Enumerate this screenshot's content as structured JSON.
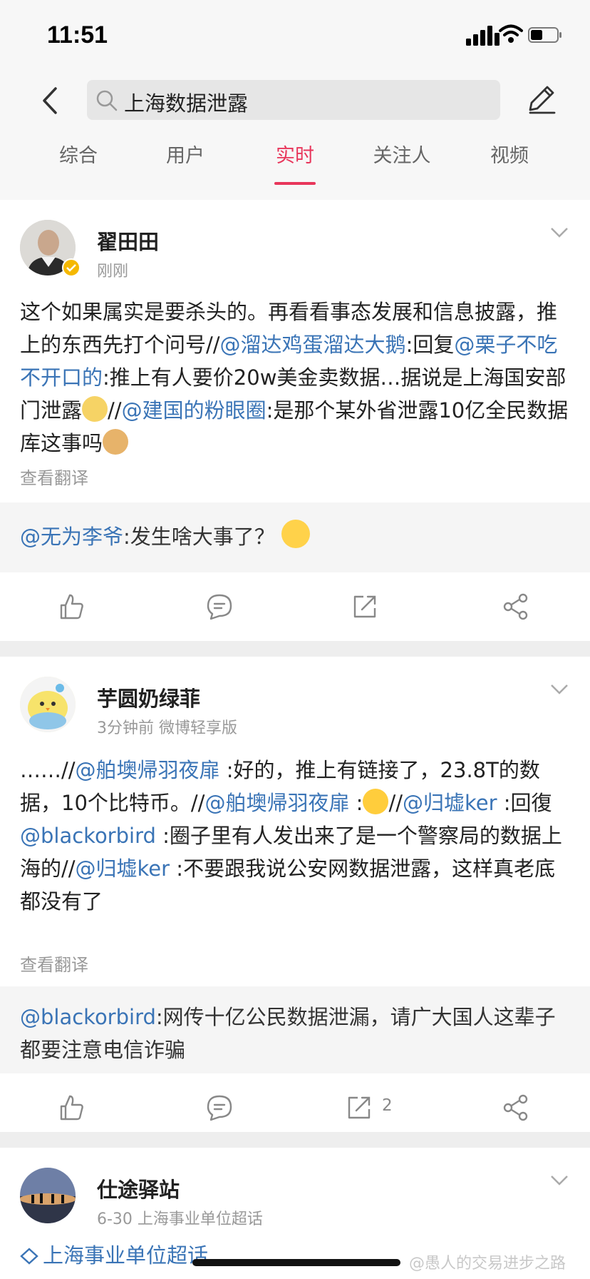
{
  "status": {
    "time": "11:51"
  },
  "search": {
    "query": "上海数据泄露"
  },
  "tabs": [
    {
      "label": "综合"
    },
    {
      "label": "用户"
    },
    {
      "label": "实时"
    },
    {
      "label": "关注人"
    },
    {
      "label": "视频"
    }
  ],
  "active_tab": "实时",
  "accent_color": "#e8365b",
  "link_color": "#3a74b6",
  "posts": [
    {
      "author": "翟田田",
      "meta": "刚刚",
      "verified": true,
      "content": {
        "t1": "这个如果属实是要杀头的。再看看事态发展和信息披露，推上的东西先打个问号//",
        "m1": "@溜达鸡蛋溜达大鹅",
        "t2": ":回复",
        "m2": "@栗子不吃不开口的",
        "t3": ":推上有人要价20w美金卖数据…据说是上海国安部门泄露",
        "t4": "//",
        "m3": "@建国的粉眼圈",
        "t5": ":是那个某外省泄露10亿全民数据库这事吗"
      },
      "translate": "查看翻译",
      "quote": {
        "mention": "@无为李爷",
        "text": ":发生啥大事了？"
      }
    },
    {
      "author": "芋圆奶绿菲",
      "meta": "3分钟前 微博轻享版",
      "content": {
        "t1": "……//",
        "m1": "@舶墺帰羽夜扉",
        "t2": " :好的，推上有链接了，23.8T的数据，10个比特币。//",
        "m2": "@舶墺帰羽夜扉",
        "t3": " :",
        "t4": "//",
        "m3": "@归墟ker",
        "t5": " :回復",
        "m4": "@blackorbird",
        "t6": " :圈子里有人发出来了是一个警察局的数据上海的//",
        "m5": "@归墟ker",
        "t7": " :不要跟我说公安网数据泄露，这样真老底都没有了"
      },
      "translate": "查看翻译",
      "quote": {
        "mention": "@blackorbird",
        "text": ":网传十亿公民数据泄漏，请广大国人这辈子都要注意电信诈骗"
      },
      "repost_count": "2"
    },
    {
      "author": "仕途驿站",
      "meta": "6-30  上海事业单位超话",
      "tag": "上海事业单位超话"
    }
  ],
  "watermark": "@愚人的交易进步之路"
}
